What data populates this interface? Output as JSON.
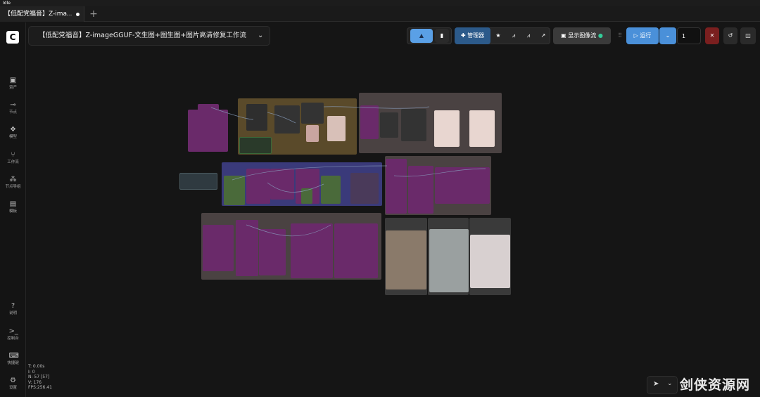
{
  "status": "Idle",
  "tab": {
    "label": "【低配党福音】Z-ima...",
    "new_tab": "+"
  },
  "workflow_title": "【低配党福音】Z-imageGGUF-文生图+图生图+图片高清修复工作流",
  "sidebar": {
    "items": [
      {
        "label": "资产",
        "icon": "image-icon"
      },
      {
        "label": "节点",
        "icon": "node-icon"
      },
      {
        "label": "模型",
        "icon": "model-icon"
      },
      {
        "label": "工作流",
        "icon": "workflow-icon"
      },
      {
        "label": "节点导组",
        "icon": "node-group-icon"
      },
      {
        "label": "模板",
        "icon": "template-icon"
      }
    ],
    "bottom_items": [
      {
        "label": "说明",
        "icon": "help-icon"
      },
      {
        "label": "控制台",
        "icon": "terminal-icon"
      },
      {
        "label": "快捷键",
        "icon": "keyboard-icon"
      },
      {
        "label": "设置",
        "icon": "gear-icon"
      }
    ]
  },
  "toolbar": {
    "manager_label": "管理器",
    "show_images_label": "显示图像流",
    "run_label": "运行",
    "batch_count": "1"
  },
  "stats": {
    "t": "T: 0.00s",
    "i": "I: 0",
    "n": "N: 57 [57]",
    "v": "V: 176",
    "fps": "FPS:256.41"
  },
  "watermark": "剑侠资源网",
  "colors": {
    "background": "#151515",
    "accent_blue": "#4a90d9",
    "node_purple": "#6a2a6a",
    "group_olive": "#5a4a2a",
    "group_blue": "#3a3a7a",
    "group_gray": "#4a4242",
    "stop_red": "#8a2020"
  }
}
